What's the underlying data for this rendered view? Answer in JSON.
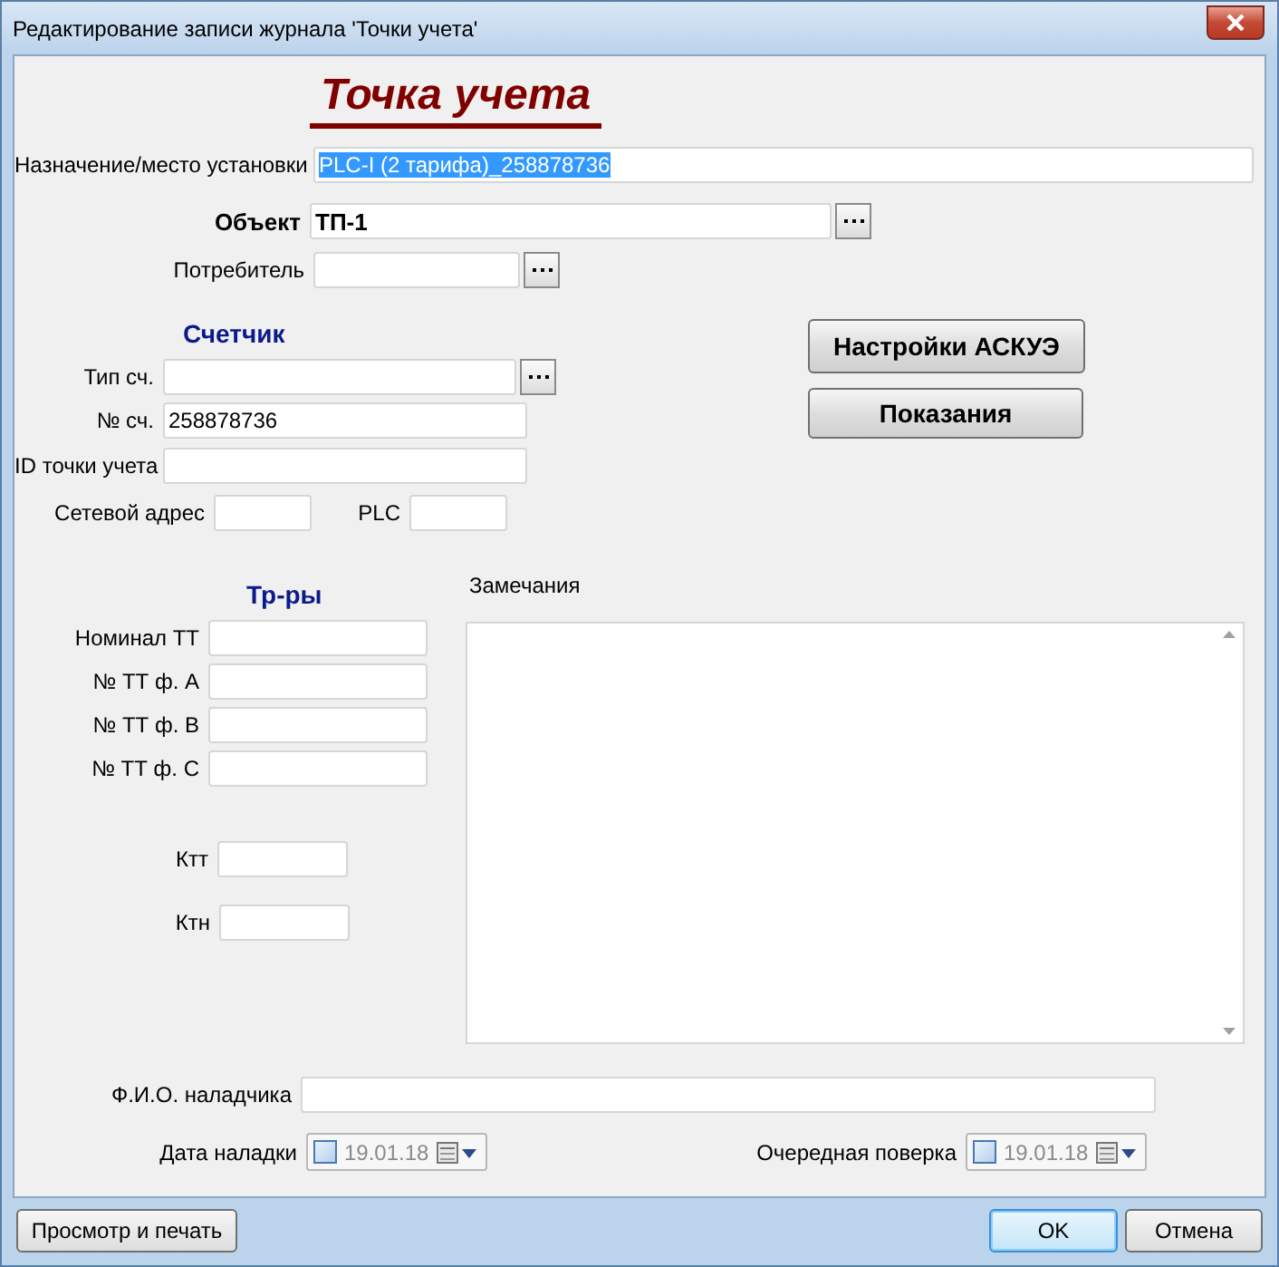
{
  "window": {
    "title": "Редактирование записи журнала 'Точки учета'"
  },
  "heading": "Точка учета",
  "top_fields": [
    {
      "kind": "text",
      "label": "Назначение/место установки",
      "value": "PLC-I (2 тарифа)_258878736",
      "text_selected": true,
      "bold": false
    },
    {
      "kind": "picker",
      "label": "Объект",
      "value": "ТП-1",
      "text_selected": false,
      "bold": true
    },
    {
      "kind": "picker",
      "label": "Потребитель",
      "bold": false
    }
  ],
  "meter": {
    "title": "Счетчик",
    "fields": [
      {
        "kind": "picker",
        "label": "Тип сч."
      },
      {
        "kind": "text",
        "label": "№ сч.",
        "value": "258878736"
      },
      {
        "kind": "text",
        "label": "ID точки учета"
      }
    ],
    "network_address": {
      "label": "Сетевой адрес"
    },
    "plc": {
      "label": "PLC"
    }
  },
  "side_buttons": [
    "Настройки АСКУЭ",
    "Показания"
  ],
  "transformers": {
    "title": "Тр-ры",
    "fields": [
      {
        "label": "Номинал ТТ"
      },
      {
        "label": "№ ТТ ф. А"
      },
      {
        "label": "№ ТТ ф. В"
      },
      {
        "label": "№ ТТ ф. С"
      }
    ],
    "ktt": {
      "label": "Ктт"
    },
    "ktn": {
      "label": "Ктн"
    }
  },
  "remarks": {
    "label": "Замечания"
  },
  "technician": {
    "label": "Ф.И.О. наладчика"
  },
  "dates": [
    {
      "label": "Дата наладки",
      "value": "19.01.18",
      "checked": false
    },
    {
      "label": "Очередная поверка",
      "value": "19.01.18",
      "checked": false
    }
  ],
  "footer": [
    {
      "label": "Просмотр и печать",
      "default": false
    },
    {
      "label": "OK",
      "default": true
    },
    {
      "label": "Отмена",
      "default": false
    }
  ]
}
